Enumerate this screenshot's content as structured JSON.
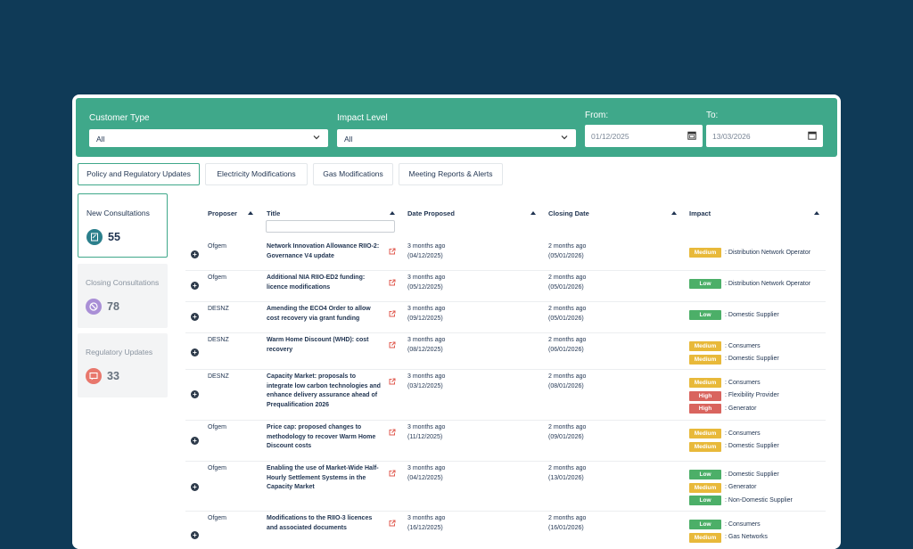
{
  "filters": {
    "customer_type_label": "Customer Type",
    "customer_type_value": "All",
    "impact_level_label": "Impact Level",
    "impact_level_value": "All",
    "from_label": "From:",
    "from_value": "01/12/2025",
    "to_label": "To:",
    "to_value": "13/03/2026"
  },
  "tabs": [
    "Policy and Regulatory Updates",
    "Electricity Modifications",
    "Gas Modifications",
    "Meeting Reports & Alerts"
  ],
  "stats": [
    {
      "label": "New Consultations",
      "count": "55"
    },
    {
      "label": "Closing Consultations",
      "count": "78"
    },
    {
      "label": "Regulatory Updates",
      "count": "33"
    }
  ],
  "table": {
    "headers": [
      "Proposer",
      "Title",
      "Date Proposed",
      "Closing Date",
      "Impact"
    ],
    "rows": [
      {
        "proposer": "Ofgem",
        "title": "Network Innovation Allowance RIIO-2: Governance V4 update",
        "proposed_rel": "3 months ago",
        "proposed_date": "(04/12/2025)",
        "closing_rel": "2 months ago",
        "closing_date": "(05/01/2026)",
        "impacts": [
          {
            "level": "Medium",
            "target": ": Distribution Network Operator"
          }
        ]
      },
      {
        "proposer": "Ofgem",
        "title": "Additional NIA RIIO-ED2 funding: licence modifications",
        "proposed_rel": "3 months ago",
        "proposed_date": "(05/12/2025)",
        "closing_rel": "2 months ago",
        "closing_date": "(05/01/2026)",
        "impacts": [
          {
            "level": "Low",
            "target": ": Distribution Network Operator"
          }
        ]
      },
      {
        "proposer": "DESNZ",
        "title": "Amending the ECO4 Order to allow cost recovery via grant funding",
        "proposed_rel": "3 months ago",
        "proposed_date": "(09/12/2025)",
        "closing_rel": "2 months ago",
        "closing_date": "(05/01/2026)",
        "impacts": [
          {
            "level": "Low",
            "target": ": Domestic Supplier"
          }
        ]
      },
      {
        "proposer": "DESNZ",
        "title": "Warm Home Discount (WHD): cost recovery",
        "proposed_rel": "3 months ago",
        "proposed_date": "(08/12/2025)",
        "closing_rel": "2 months ago",
        "closing_date": "(06/01/2026)",
        "impacts": [
          {
            "level": "Medium",
            "target": ": Consumers"
          },
          {
            "level": "Medium",
            "target": ": Domestic Supplier"
          }
        ]
      },
      {
        "proposer": "DESNZ",
        "title": "Capacity Market: proposals to integrate low carbon technologies and enhance delivery assurance ahead of Prequalification 2026",
        "proposed_rel": "3 months ago",
        "proposed_date": "(03/12/2025)",
        "closing_rel": "2 months ago",
        "closing_date": "(08/01/2026)",
        "impacts": [
          {
            "level": "Medium",
            "target": ": Consumers"
          },
          {
            "level": "High",
            "target": ": Flexibility Provider"
          },
          {
            "level": "High",
            "target": ": Generator"
          }
        ]
      },
      {
        "proposer": "Ofgem",
        "title": "Price cap: proposed changes to methodology to recover Warm Home Discount costs",
        "proposed_rel": "3 months ago",
        "proposed_date": "(11/12/2025)",
        "closing_rel": "2 months ago",
        "closing_date": "(09/01/2026)",
        "impacts": [
          {
            "level": "Medium",
            "target": ": Consumers"
          },
          {
            "level": "Medium",
            "target": ": Domestic Supplier"
          }
        ]
      },
      {
        "proposer": "Ofgem",
        "title": "Enabling the use of Market-Wide Half-Hourly Settlement Systems in the Capacity Market",
        "proposed_rel": "3 months ago",
        "proposed_date": "(04/12/2025)",
        "closing_rel": "2 months ago",
        "closing_date": "(13/01/2026)",
        "impacts": [
          {
            "level": "Low",
            "target": ": Domestic Supplier"
          },
          {
            "level": "Medium",
            "target": ": Generator"
          },
          {
            "level": "Low",
            "target": ": Non-Domestic Supplier"
          }
        ]
      },
      {
        "proposer": "Ofgem",
        "title": "Modifications to the RIIO-3 licences and associated documents",
        "proposed_rel": "3 months ago",
        "proposed_date": "(16/12/2025)",
        "closing_rel": "2 months ago",
        "closing_date": "(16/01/2026)",
        "impacts": [
          {
            "level": "Low",
            "target": ": Consumers"
          },
          {
            "level": "Medium",
            "target": ": Gas Networks"
          }
        ]
      }
    ]
  },
  "colors": {
    "Medium": "#e8b93a",
    "Low": "#4caf68",
    "High": "#d9645e",
    "accent": "#3fa88a"
  }
}
